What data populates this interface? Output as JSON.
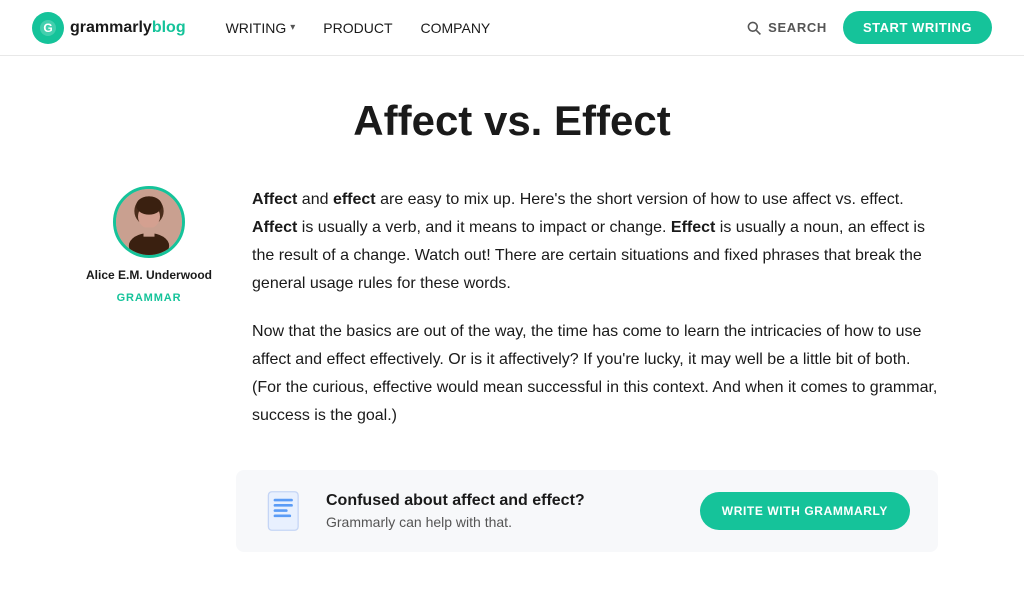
{
  "nav": {
    "logo_text": "grammarly",
    "logo_blog": " blog",
    "links": [
      {
        "label": "WRITING",
        "has_dropdown": true
      },
      {
        "label": "PRODUCT",
        "has_dropdown": false
      },
      {
        "label": "COMPANY",
        "has_dropdown": false
      }
    ],
    "search_label": "SEARCH",
    "start_writing_label": "START WRITING"
  },
  "article": {
    "title": "Affect vs. Effect",
    "author_name": "Alice E.M. Underwood",
    "author_tag": "GRAMMAR",
    "paragraph1": "are easy to mix up. Here's the short version of how to use affect vs. effect.",
    "paragraph1_full": "Affect and effect are easy to mix up. Here's the short version of how to use affect vs. effect. Affect is usually a verb, and it means to impact or change. Effect is usually a noun, an effect is the result of a change. Watch out! There are certain situations and fixed phrases that break the general usage rules for these words.",
    "paragraph2": "Now that the basics are out of the way, the time has come to learn the intricacies of how to use affect and effect effectively. Or is it affectively? If you're lucky, it may well be a little bit of both. (For the curious, effective would mean successful in this context. And when it comes to grammar, success is the goal.)",
    "cta_heading": "Confused about affect and effect?",
    "cta_subtext": "Grammarly can help with that.",
    "cta_button": "WRITE WITH GRAMMARLY"
  }
}
